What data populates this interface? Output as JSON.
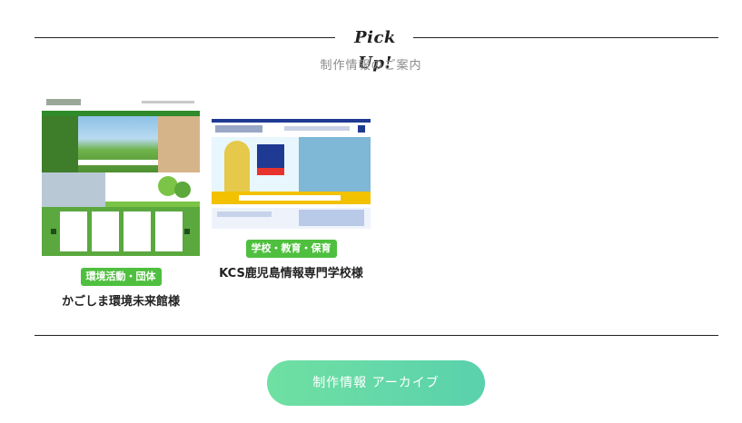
{
  "heading": {
    "title": "Pick Up!",
    "subtitle": "制作情報のご案内"
  },
  "cards": [
    {
      "badge": "環境活動・団体",
      "name": "かごしま環境未来館様"
    },
    {
      "badge": "学校・教育・保育",
      "name": "KCS鹿児島情報専門学校様"
    }
  ],
  "archive_button": {
    "label": "制作情報 アーカイブ"
  },
  "colors": {
    "badge": "#4fbf3f",
    "button_start": "#6fe0a2",
    "button_end": "#5ad1ad",
    "rule": "#222222"
  }
}
